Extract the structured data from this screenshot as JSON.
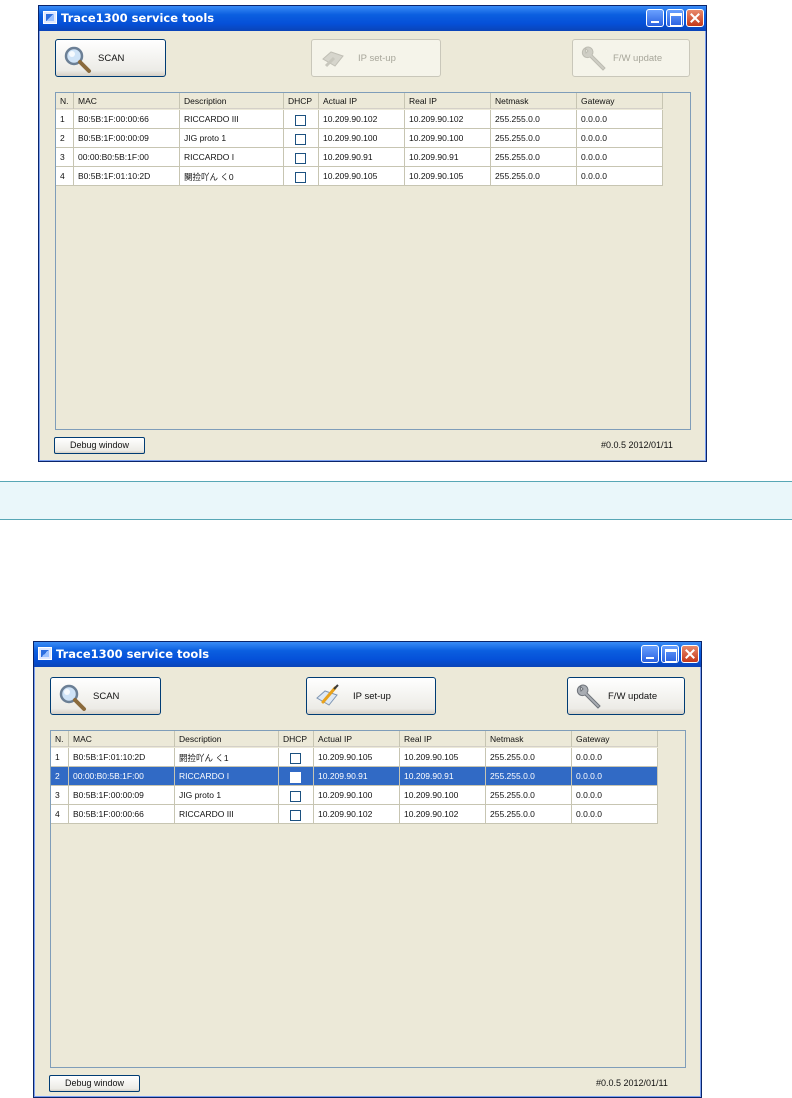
{
  "colors": {
    "titlebar": "#0550d8",
    "selection": "#316ac5",
    "window_bg": "#ece9d8",
    "divider": "#eaf7fa"
  },
  "window1": {
    "title": "Trace1300 service tools",
    "icons": {
      "scan": "magnifier-icon",
      "ip": "ip-setup-icon",
      "fw": "wrench-icon"
    },
    "scan_label": "SCAN",
    "ip_setup_label": "IP set-up",
    "ip_setup_enabled": false,
    "fw_update_label": "F/W update",
    "fw_update_enabled": false,
    "columns": [
      "N.",
      "MAC",
      "Description",
      "DHCP",
      "Actual IP",
      "Real IP",
      "Netmask",
      "Gateway"
    ],
    "rows": [
      {
        "n": "1",
        "mac": "B0:5B:1F:00:00:66",
        "description": "RICCARDO III",
        "dhcp": false,
        "actual_ip": "10.209.90.102",
        "real_ip": "10.209.90.102",
        "netmask": "255.255.0.0",
        "gateway": "0.0.0.0"
      },
      {
        "n": "2",
        "mac": "B0:5B:1F:00:00:09",
        "description": "JIG proto 1",
        "dhcp": false,
        "actual_ip": "10.209.90.100",
        "real_ip": "10.209.90.100",
        "netmask": "255.255.0.0",
        "gateway": "0.0.0.0"
      },
      {
        "n": "3",
        "mac": "00:00:B0:5B:1F:00",
        "description": "RICCARDO I",
        "dhcp": false,
        "actual_ip": "10.209.90.91",
        "real_ip": "10.209.90.91",
        "netmask": "255.255.0.0",
        "gateway": "0.0.0.0"
      },
      {
        "n": "4",
        "mac": "B0:5B:1F:01:10:2D",
        "description": "闋捡吖ん く0",
        "dhcp": false,
        "actual_ip": "10.209.90.105",
        "real_ip": "10.209.90.105",
        "netmask": "255.255.0.0",
        "gateway": "0.0.0.0"
      }
    ],
    "debug_label": "Debug window",
    "version": "#0.0.5   2012/01/11"
  },
  "window2": {
    "title": "Trace1300 service tools",
    "icons": {
      "scan": "magnifier-icon",
      "ip": "ip-setup-icon",
      "fw": "wrench-icon"
    },
    "scan_label": "SCAN",
    "ip_setup_label": "IP set-up",
    "ip_setup_enabled": true,
    "fw_update_label": "F/W update",
    "fw_update_enabled": true,
    "columns": [
      "N.",
      "MAC",
      "Description",
      "DHCP",
      "Actual IP",
      "Real IP",
      "Netmask",
      "Gateway"
    ],
    "selected_row": 2,
    "rows": [
      {
        "n": "1",
        "mac": "B0:5B:1F:01:10:2D",
        "description": "閼捡吖ん く1",
        "dhcp": false,
        "actual_ip": "10.209.90.105",
        "real_ip": "10.209.90.105",
        "netmask": "255.255.0.0",
        "gateway": "0.0.0.0"
      },
      {
        "n": "2",
        "mac": "00:00:B0:5B:1F:00",
        "description": "RICCARDO I",
        "dhcp": false,
        "actual_ip": "10.209.90.91",
        "real_ip": "10.209.90.91",
        "netmask": "255.255.0.0",
        "gateway": "0.0.0.0"
      },
      {
        "n": "3",
        "mac": "B0:5B:1F:00:00:09",
        "description": "JIG proto 1",
        "dhcp": false,
        "actual_ip": "10.209.90.100",
        "real_ip": "10.209.90.100",
        "netmask": "255.255.0.0",
        "gateway": "0.0.0.0"
      },
      {
        "n": "4",
        "mac": "B0:5B:1F:00:00:66",
        "description": "RICCARDO III",
        "dhcp": false,
        "actual_ip": "10.209.90.102",
        "real_ip": "10.209.90.102",
        "netmask": "255.255.0.0",
        "gateway": "0.0.0.0"
      }
    ],
    "debug_label": "Debug window",
    "version": "#0.0.5   2012/01/11"
  }
}
